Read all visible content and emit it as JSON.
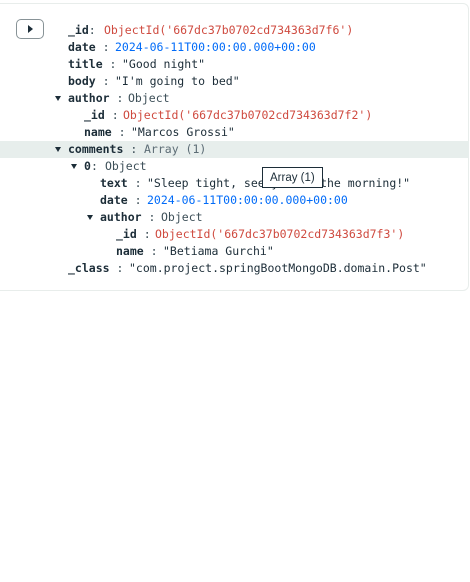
{
  "document": {
    "id": {
      "key": "_id",
      "value": "ObjectId('667dc37b0702cd734363d7f6')"
    },
    "date": {
      "key": "date",
      "value": "2024-06-11T00:00:00.000+00:00"
    },
    "title": {
      "key": "title",
      "value": "\"Good night\""
    },
    "body": {
      "key": "body",
      "value": "\"I'm going to bed\""
    },
    "author": {
      "key": "author",
      "type": "Object",
      "id": {
        "key": "_id",
        "value": "ObjectId('667dc37b0702cd734363d7f2')"
      },
      "name": {
        "key": "name",
        "value": "\"Marcos Grossi\""
      }
    },
    "comments": {
      "key": "comments",
      "type": "Array (1)",
      "item0": {
        "key": "0",
        "type": "Object",
        "text": {
          "key": "text",
          "value": "\"Sleep tight, see you in the morning!\""
        },
        "date": {
          "key": "date",
          "value": "2024-06-11T00:00:00.000+00:00"
        },
        "author": {
          "key": "author",
          "type": "Object",
          "id": {
            "key": "_id",
            "value": "ObjectId('667dc37b0702cd734363d7f3')"
          },
          "name": {
            "key": "name",
            "value": "\"Betiama Gurchi\""
          }
        }
      }
    },
    "class": {
      "key": "_class",
      "value": "\"com.project.springBootMongoDB.domain.Post\""
    }
  },
  "tooltip": "Array (1)",
  "icons": {
    "expand": "caret-right-icon",
    "collapse": "caret-down-icon"
  }
}
